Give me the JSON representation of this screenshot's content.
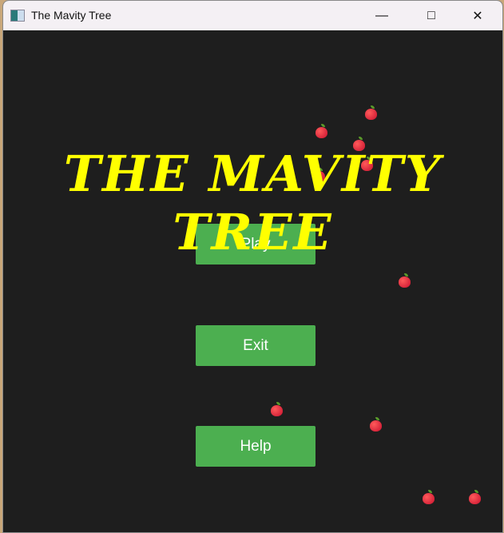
{
  "window": {
    "title": "The Mavity Tree",
    "minimize_icon": "minimize-icon",
    "maximize_icon": "maximize-icon",
    "close_icon": "close-icon"
  },
  "game": {
    "title": "THE MAVITY TREE",
    "buttons": [
      {
        "label": "Play"
      },
      {
        "label": "Exit"
      },
      {
        "label": "Help"
      }
    ],
    "colors": {
      "background": "#1e1e1e",
      "title": "#ffff00",
      "button": "#4caf50",
      "button_text": "#ffffff"
    },
    "decoration_icon": "apple-icon"
  }
}
